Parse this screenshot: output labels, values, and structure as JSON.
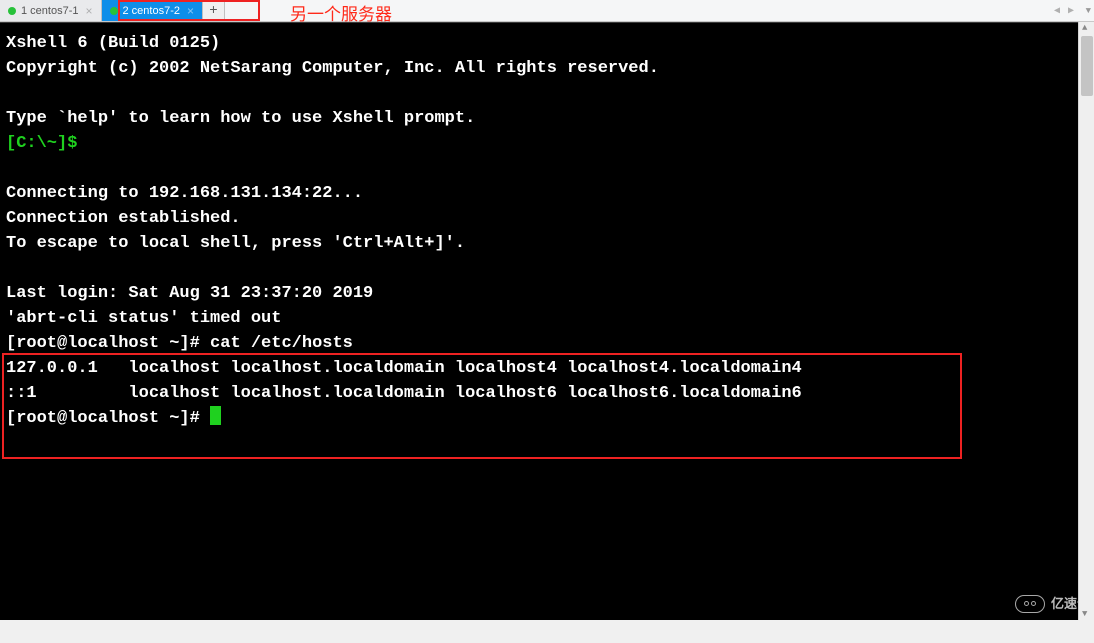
{
  "tabs": [
    {
      "label": "1 centos7-1",
      "active": false
    },
    {
      "label": "2 centos7-2",
      "active": true
    }
  ],
  "new_tab_glyph": "+",
  "nav": {
    "left": "◀",
    "right": "▶",
    "dropdown": "▼"
  },
  "annotation_text": "另一个服务器",
  "terminal": {
    "line1": "Xshell 6 (Build 0125)",
    "line2": "Copyright (c) 2002 NetSarang Computer, Inc. All rights reserved.",
    "blank1": "",
    "line3": "Type `help' to learn how to use Xshell prompt.",
    "prompt_local": "[C:\\~]$",
    "blank2": "",
    "conn1": "Connecting to 192.168.131.134:22...",
    "conn2": "Connection established.",
    "conn3": "To escape to local shell, press 'Ctrl+Alt+]'.",
    "blank3": "",
    "login": "Last login: Sat Aug 31 23:37:20 2019",
    "abrt": "'abrt-cli status' timed out",
    "cmd_prompt1": "[root@localhost ~]# ",
    "cmd1": "cat /etc/hosts",
    "hosts1": "127.0.0.1   localhost localhost.localdomain localhost4 localhost4.localdomain4",
    "hosts2": "::1         localhost localhost.localdomain localhost6 localhost6.localdomain6",
    "cmd_prompt2": "[root@localhost ~]# "
  },
  "watermark": "亿速云"
}
